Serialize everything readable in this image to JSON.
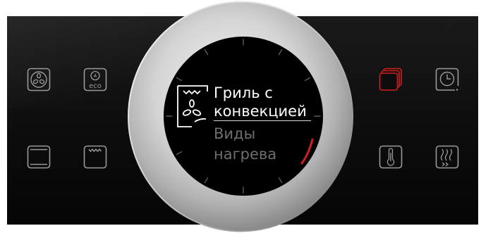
{
  "display": {
    "selected_mode_line1": "Гриль с",
    "selected_mode_line2": "конвекцией",
    "menu_title_line1": "Виды",
    "menu_title_line2": "нагрева"
  },
  "buttons_left": [
    {
      "icon": "fan-icon"
    },
    {
      "icon": "eco-fan-icon",
      "label": "eco"
    },
    {
      "icon": "top-bottom-heat-icon"
    },
    {
      "icon": "grill-icon"
    }
  ],
  "buttons_right": [
    {
      "icon": "multiple-dishes-icon",
      "active_color": "#cc1f1f"
    },
    {
      "icon": "timer-icon"
    },
    {
      "icon": "thermometer-icon"
    },
    {
      "icon": "steam-icon"
    }
  ],
  "colors": {
    "accent_red": "#d01e1e",
    "icon_gray": "#9a9a9a",
    "panel_black": "#0d0d0d"
  }
}
